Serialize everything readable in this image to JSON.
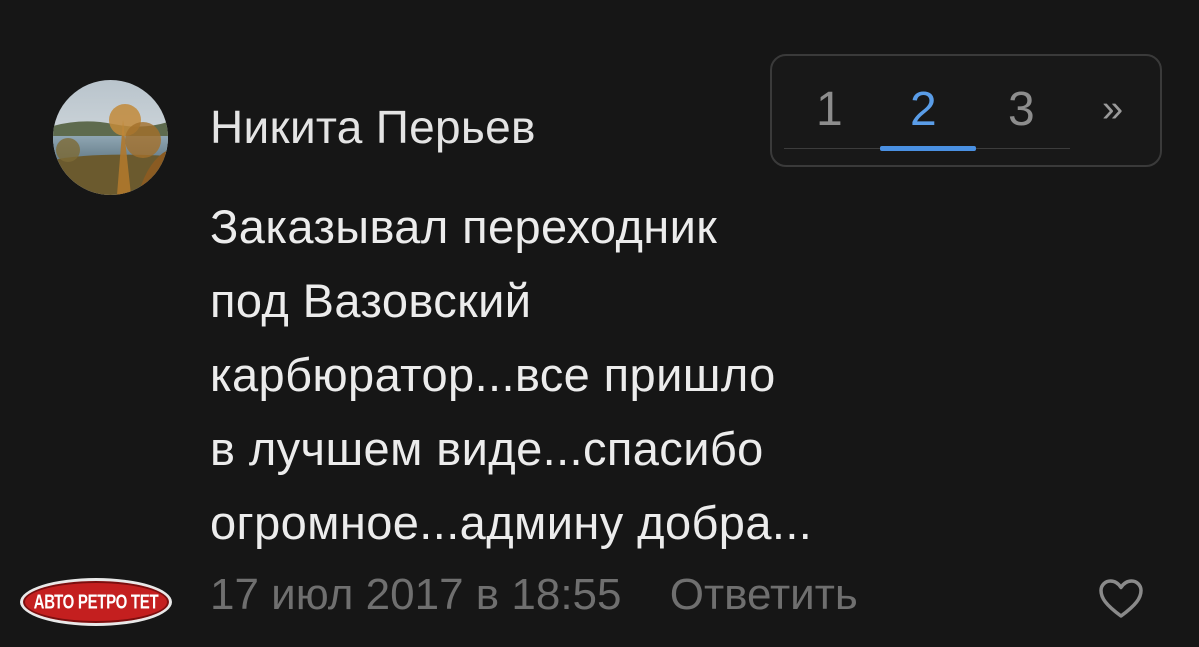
{
  "comment": {
    "author": "Никита Перьев",
    "text_lines": [
      "Заказывал переходник",
      "под Вазовский",
      "карбюратор...все пришло",
      "в лучшем виде...спасибо",
      "огромное...админу добра..."
    ],
    "timestamp": "17 июл 2017 в 18:55",
    "reply_label": "Ответить",
    "avatar_icon": "avatar-landscape-photo",
    "like_icon": "heart-outline-icon"
  },
  "pagination": {
    "pages": [
      "1",
      "2",
      "3"
    ],
    "next_label": "»",
    "current_page": "2",
    "accent_color": "#4a90e2"
  },
  "watermark": {
    "text": "АВТО РЕТРО ТЕТ",
    "color": "#c41f1f"
  }
}
